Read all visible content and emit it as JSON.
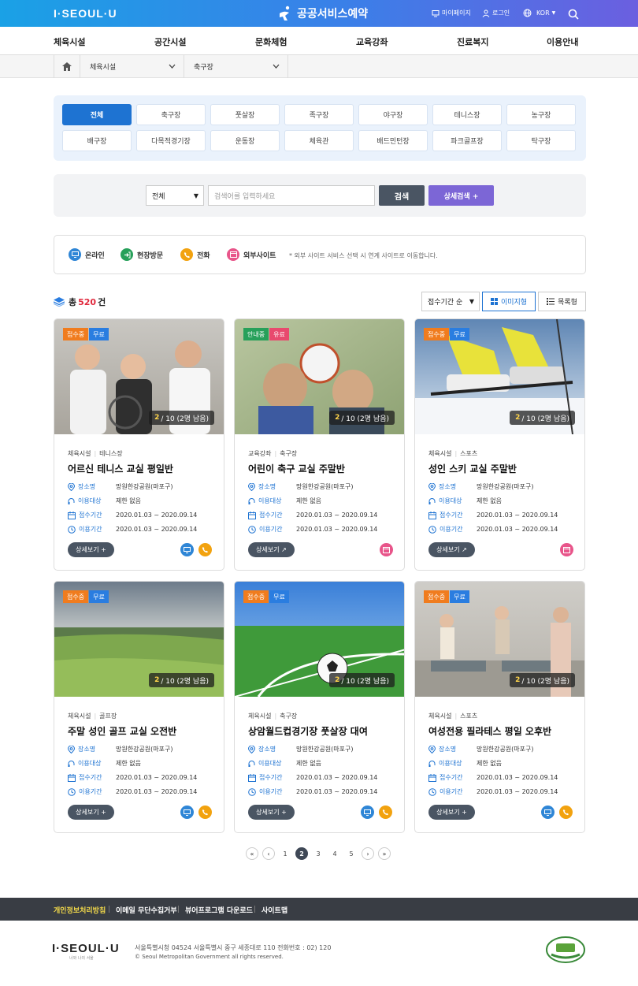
{
  "header": {
    "logo": "I·SEOUL·U",
    "brand": "공공서비스예약",
    "mypage": "마이페이지",
    "login": "로그인",
    "lang": "KOR"
  },
  "gnb": [
    "체육시설",
    "공간시설",
    "문화체험",
    "교육강좌",
    "진료복지",
    "이용안내"
  ],
  "breadcrumb": {
    "level1": "체육시설",
    "level2": "축구장"
  },
  "categories": [
    "전체",
    "축구장",
    "풋살장",
    "족구장",
    "야구장",
    "테니스장",
    "농구장",
    "배구장",
    "다목적경기장",
    "운동장",
    "체육관",
    "배드민턴장",
    "파크골프장",
    "탁구장"
  ],
  "search": {
    "select": "전체",
    "placeholder": "검색어를 입력하세요",
    "button": "검색",
    "advanced": "상세검색 +"
  },
  "legend": {
    "online": "온라인",
    "visit": "현장방문",
    "phone": "전화",
    "external": "외부사이트",
    "note": "* 외부 사이트 서비스 선택 시 연계 사이트로 이동합니다."
  },
  "list": {
    "total_prefix": "총",
    "total": "520",
    "total_suffix": "건",
    "sort": "접수기간 순",
    "view_image": "이미지형",
    "view_list": "목록형"
  },
  "labels": {
    "place": "장소명",
    "target": "이용대상",
    "apply": "접수기간",
    "use": "이용기간"
  },
  "cards": [
    {
      "status": "접수중",
      "fee": "무료",
      "count": "2",
      "count_rest": "/ 10 (2명 남음)",
      "cat1": "체육시설",
      "cat2": "테니스장",
      "title": "어르신 테니스 교실 평일반",
      "place": "망원한강공원(마포구)",
      "target": "제한 없음",
      "apply": "2020.01.03 ~ 2020.09.14",
      "use": "2020.01.03 ~ 2020.09.14",
      "more": "상세보기 +"
    },
    {
      "status": "안내중",
      "fee": "유료",
      "count": "2",
      "count_rest": "/ 10 (2명 남음)",
      "cat1": "교육강좌",
      "cat2": "축구장",
      "title": "어린이 축구 교실 주말반",
      "place": "망원한강공원(마포구)",
      "target": "제한 없음",
      "apply": "2020.01.03 ~ 2020.09.14",
      "use": "2020.01.03 ~ 2020.09.14",
      "more": "상세보기 ↗"
    },
    {
      "status": "접수중",
      "fee": "무료",
      "count": "2",
      "count_rest": "/ 10 (2명 남음)",
      "cat1": "체육시설",
      "cat2": "스포츠",
      "title": "성인 스키 교실 주말반",
      "place": "망원한강공원(마포구)",
      "target": "제한 없음",
      "apply": "2020.01.03 ~ 2020.09.14",
      "use": "2020.01.03 ~ 2020.09.14",
      "more": "상세보기 ↗"
    },
    {
      "status": "접수중",
      "fee": "무료",
      "count": "2",
      "count_rest": "/ 10 (2명 남음)",
      "cat1": "체육시설",
      "cat2": "골프장",
      "title": "주말 성인 골프 교실 오전반",
      "place": "망원한강공원(마포구)",
      "target": "제한 없음",
      "apply": "2020.01.03 ~ 2020.09.14",
      "use": "2020.01.03 ~ 2020.09.14",
      "more": "상세보기 +"
    },
    {
      "status": "접수중",
      "fee": "무료",
      "count": "2",
      "count_rest": "/ 10 (2명 남음)",
      "cat1": "체육시설",
      "cat2": "축구장",
      "title": "상암월드컵경기장 풋살장 대여",
      "place": "망원한강공원(마포구)",
      "target": "제한 없음",
      "apply": "2020.01.03 ~ 2020.09.14",
      "use": "2020.01.03 ~ 2020.09.14",
      "more": "상세보기 +"
    },
    {
      "status": "접수중",
      "fee": "무료",
      "count": "2",
      "count_rest": "/ 10 (2명 남음)",
      "cat1": "체육시설",
      "cat2": "스포츠",
      "title": "여성전용 필라테스 평일 오후반",
      "place": "망원한강공원(마포구)",
      "target": "제한 없음",
      "apply": "2020.01.03 ~ 2020.09.14",
      "use": "2020.01.03 ~ 2020.09.14",
      "more": "상세보기 +"
    }
  ],
  "pager": [
    "1",
    "2",
    "3",
    "4",
    "5"
  ],
  "footer": {
    "links": [
      "개인정보처리방침",
      "이메일 무단수집거부",
      "뷰어프로그램 다운로드",
      "사이트맵"
    ],
    "logo": "I·SEOUL·U",
    "logo_sub": "너와 나의 서울",
    "address": "서울특별시청 04524 서울특별시 중구 세종대로 110 전화번호 : 02) 120",
    "copyright": "© Seoul Metropolitan Government all rights reserved."
  },
  "colors": {
    "primary": "#1e73d2",
    "online": "#2f86d6",
    "visit": "#27a05a",
    "phone": "#f2a20f",
    "external": "#e8558a",
    "status_on": "#f07c1e",
    "status_info": "#27a05a",
    "fee_free": "#2a7de0",
    "fee_paid": "#e84a6e"
  }
}
